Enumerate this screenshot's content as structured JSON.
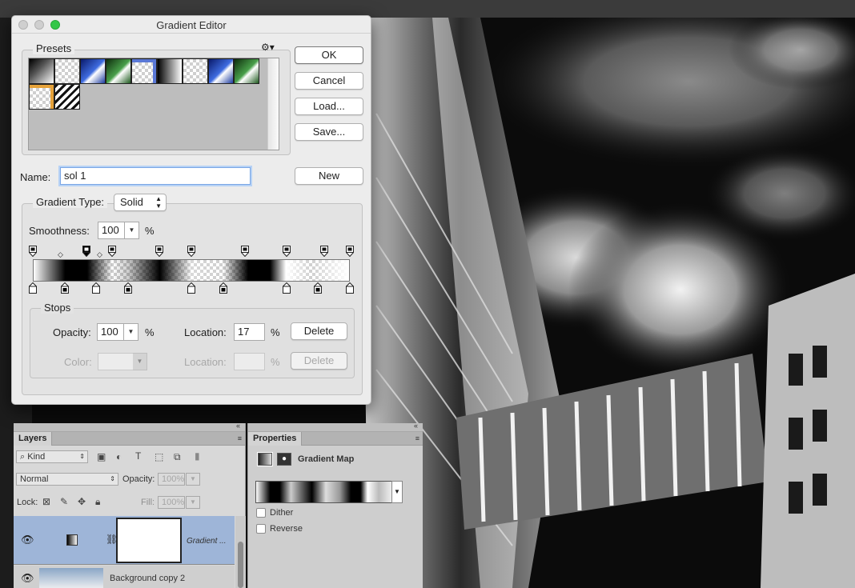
{
  "editor": {
    "title": "Gradient Editor",
    "presets_label": "Presets",
    "presets_menu_icon": "gear-icon",
    "presets": [
      {
        "kind": "black-transparent"
      },
      {
        "kind": "transparent-stripes"
      },
      {
        "kind": "blue"
      },
      {
        "kind": "green"
      },
      {
        "kind": "blue-transparent"
      },
      {
        "kind": "black-white"
      },
      {
        "kind": "transparent-stripes"
      },
      {
        "kind": "blue"
      },
      {
        "kind": "green"
      },
      {
        "kind": "orange-transparent"
      },
      {
        "kind": "black-stripes"
      }
    ],
    "buttons": {
      "ok": "OK",
      "cancel": "Cancel",
      "load": "Load...",
      "save": "Save...",
      "new": "New"
    },
    "name_label": "Name:",
    "name_value": "sol 1",
    "gradient_type_label": "Gradient Type:",
    "gradient_type_value": "Solid",
    "smoothness_label": "Smoothness:",
    "smoothness_value": "100",
    "percent": "%",
    "stops_label": "Stops",
    "opacity_label": "Opacity:",
    "opacity_value": "100",
    "location_label": "Location:",
    "location_value": "17",
    "delete_label": "Delete",
    "color_label": "Color:",
    "location2_label": "Location:",
    "location2_value": "",
    "delete2_label": "Delete",
    "opacity_stops": [
      0,
      17,
      25,
      40,
      50,
      67,
      80,
      92,
      100
    ],
    "selected_opacity_stop": 17,
    "color_stops": [
      0,
      10,
      20,
      30,
      50,
      60,
      80,
      90,
      100
    ],
    "colors": {
      "accent": "#7aa7e6",
      "selection": "#9eb5d8"
    }
  },
  "layers": {
    "tab": "Layers",
    "kind_filter": "Kind",
    "blend_mode": "Normal",
    "opacity_label": "Opacity:",
    "opacity_value": "100%",
    "lock_label": "Lock:",
    "fill_label": "Fill:",
    "fill_value": "100%",
    "rows": [
      {
        "name": "Gradient ...",
        "selected": true
      },
      {
        "name": "Background copy 2",
        "selected": false
      }
    ]
  },
  "properties": {
    "tab": "Properties",
    "title": "Gradient Map",
    "dither_label": "Dither",
    "reverse_label": "Reverse",
    "dither_checked": false,
    "reverse_checked": false
  }
}
